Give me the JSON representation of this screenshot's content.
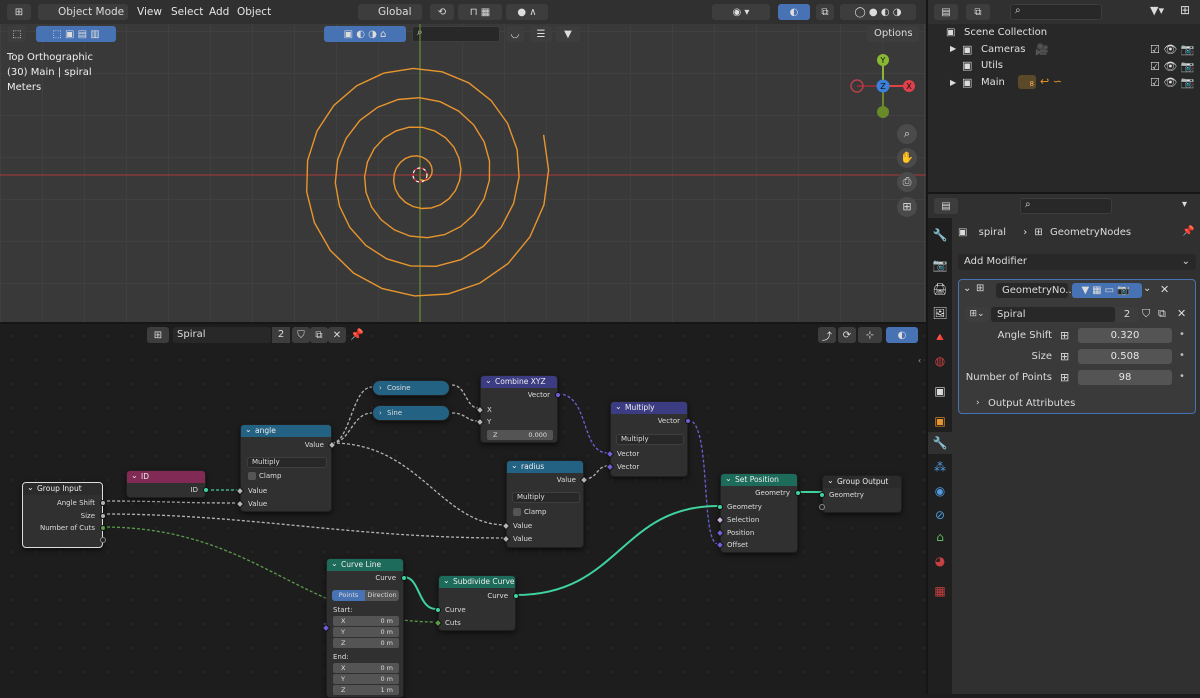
{
  "top_header": {
    "mode_label": "Object Mode",
    "menus": [
      "View",
      "Select",
      "Add",
      "Object"
    ],
    "transform_orientation": "Global",
    "options_label": "Options"
  },
  "viewport": {
    "view_name": "Top Orthographic",
    "collection_info": "(30) Main | spiral",
    "units": "Meters",
    "gizmo_labels": {
      "y": "Y",
      "z": "Z",
      "x": "X"
    }
  },
  "outliner": {
    "scene_collection": "Scene Collection",
    "items": [
      {
        "label": "Cameras"
      },
      {
        "label": "Utils"
      },
      {
        "label": "Main",
        "badge": "8"
      }
    ]
  },
  "properties": {
    "breadcrumb_object": "spiral",
    "breadcrumb_modifier": "GeometryNodes",
    "add_modifier": "Add Modifier",
    "modifier_name": "GeometryNo...",
    "node_group": "Spiral",
    "node_group_users": "2",
    "inputs": [
      {
        "label": "Angle Shift",
        "value": "0.320"
      },
      {
        "label": "Size",
        "value": "0.508"
      },
      {
        "label": "Number of Points",
        "value": "98"
      }
    ],
    "output_attributes": "Output Attributes"
  },
  "node_header": {
    "group_name": "Spiral",
    "users": "2"
  },
  "nodes": {
    "group_input": {
      "title": "Group Input",
      "outputs": [
        "Angle Shift",
        "Size",
        "Number of Cuts"
      ]
    },
    "id": {
      "title": "ID",
      "output": "ID"
    },
    "angle": {
      "title": "angle",
      "output": "Value",
      "operation": "Multiply",
      "clamp": "Clamp",
      "inputs": [
        "Value",
        "Value"
      ]
    },
    "cosine": {
      "title": "Cosine"
    },
    "sine": {
      "title": "Sine"
    },
    "combine": {
      "title": "Combine XYZ",
      "output": "Vector",
      "inputs": [
        "X",
        "Y"
      ],
      "z_label": "Z",
      "z_value": "0.000"
    },
    "radius": {
      "title": "radius",
      "output": "Value",
      "operation": "Multiply",
      "clamp": "Clamp",
      "inputs": [
        "Value",
        "Value"
      ]
    },
    "multiply": {
      "title": "Multiply",
      "output": "Vector",
      "operation": "Multiply",
      "inputs": [
        "Vector",
        "Vector"
      ]
    },
    "set_position": {
      "title": "Set Position",
      "output": "Geometry",
      "inputs": [
        "Geometry",
        "Selection",
        "Position",
        "Offset"
      ]
    },
    "group_output": {
      "title": "Group Output",
      "input": "Geometry"
    },
    "curve_line": {
      "title": "Curve Line",
      "output": "Curve",
      "mode_a": "Points",
      "mode_b": "Direction",
      "start": "Start:",
      "end": "End:",
      "start_vals": [
        [
          "X",
          "0 m"
        ],
        [
          "Y",
          "0 m"
        ],
        [
          "Z",
          "0 m"
        ]
      ],
      "end_vals": [
        [
          "X",
          "0 m"
        ],
        [
          "Y",
          "0 m"
        ],
        [
          "Z",
          "1 m"
        ]
      ]
    },
    "subdivide": {
      "title": "Subdivide Curve",
      "output": "Curve",
      "inputs": [
        "Curve",
        "Cuts"
      ]
    }
  },
  "colors": {
    "accent": "#4772b3",
    "spiral": "#e8952d",
    "header_input": "#2b2b2b",
    "header_math": "#246283",
    "header_attr": "#812a55",
    "header_vector": "#3c3c83",
    "header_geometry": "#1d6b5a",
    "geometry_link": "#3fd39e"
  }
}
